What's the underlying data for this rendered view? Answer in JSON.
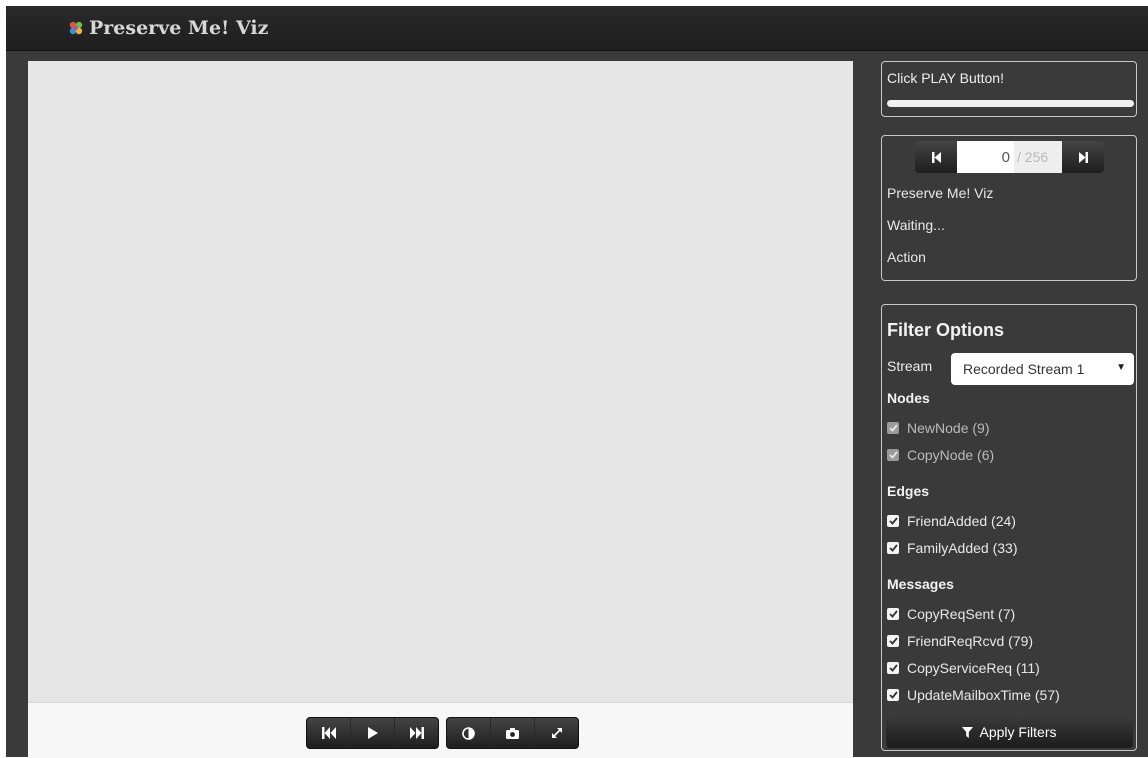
{
  "app": {
    "title": "Preserve Me! Viz",
    "brand_icon": "flower-logo-icon"
  },
  "status": {
    "message": "Click PLAY Button!",
    "progress": 0
  },
  "stepper": {
    "current": "0",
    "total": "/ 256"
  },
  "info": {
    "title": "Preserve Me! Viz",
    "state": "Waiting...",
    "action": "Action"
  },
  "filters": {
    "title": "Filter Options",
    "stream_label": "Stream",
    "stream_value": "Recorded Stream 1",
    "sections": {
      "nodes": "Nodes",
      "edges": "Edges",
      "messages": "Messages"
    },
    "nodes": [
      {
        "label": "NewNode (9)",
        "checked": true,
        "disabled": true
      },
      {
        "label": "CopyNode (6)",
        "checked": true,
        "disabled": true
      }
    ],
    "edges": [
      {
        "label": "FriendAdded (24)",
        "checked": true
      },
      {
        "label": "FamilyAdded (33)",
        "checked": true
      }
    ],
    "messages": [
      {
        "label": "CopyReqSent (7)",
        "checked": true
      },
      {
        "label": "FriendReqRcvd (79)",
        "checked": true
      },
      {
        "label": "CopyServiceReq (11)",
        "checked": true
      },
      {
        "label": "UpdateMailboxTime (57)",
        "checked": true
      }
    ],
    "apply_label": "Apply Filters"
  },
  "playback": {
    "buttons": [
      "skip-to-start-icon",
      "play-icon",
      "skip-to-end-icon",
      "contrast-icon",
      "camera-icon",
      "fullscreen-icon"
    ]
  },
  "colors": {
    "navbar": "#222222",
    "panel_bg": "#3a3a3a",
    "viz_bg": "#e6e6e6"
  }
}
